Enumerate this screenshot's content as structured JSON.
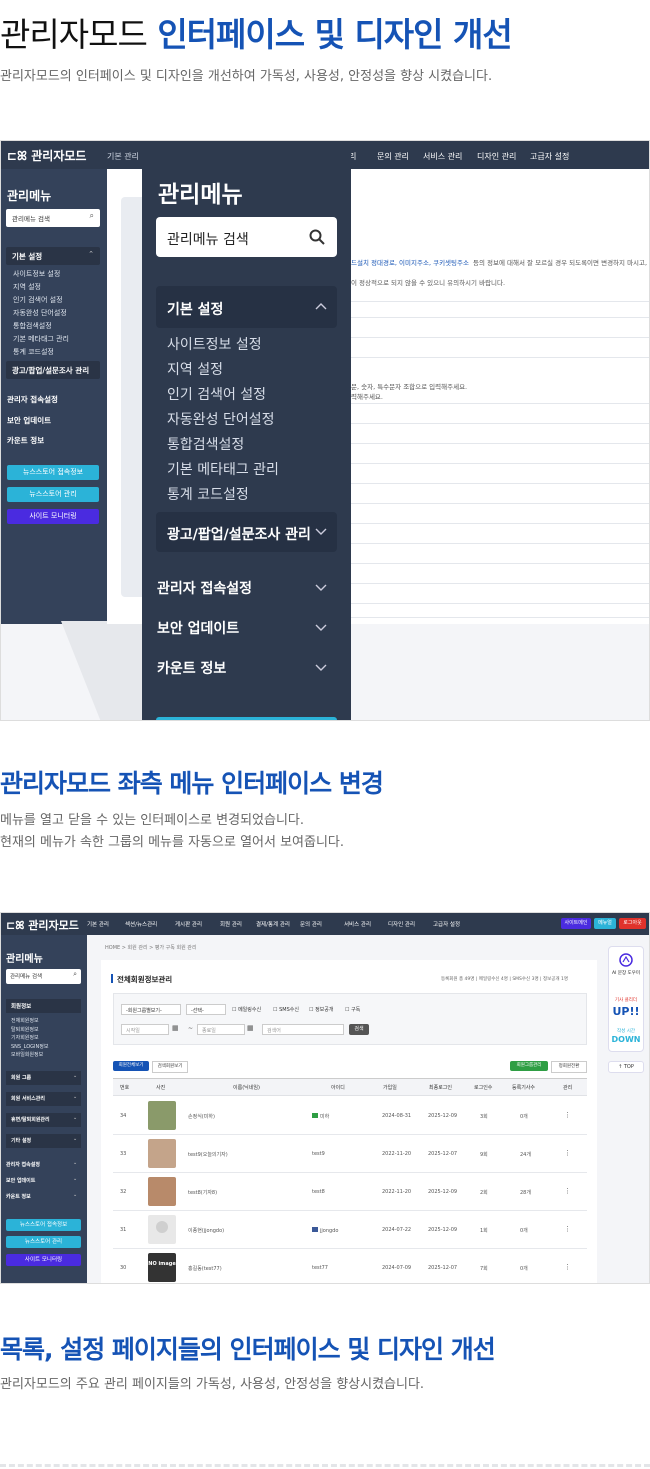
{
  "section1": {
    "title_normal": "관리자모드",
    "title_blue": "인터페이스 및 디자인 개선",
    "desc": "관리자모드의 인터페이스 및 디자인을 개선하여 가독성, 사용성, 안정성을 향상 시켰습니다."
  },
  "shot1": {
    "logo": "관리자모드",
    "topnav": [
      "기본 관리",
      "문의 관리",
      "서비스 관리",
      "디자인 관리",
      "고급자 설정"
    ],
    "sidebar_title": "관리메뉴",
    "search_placeholder": "관리메뉴 검색",
    "group_basic": "기본 설정",
    "basic_items": [
      "사이트정보 설정",
      "지역 설정",
      "인기 검색어 설정",
      "자동완성 단어설정",
      "통합검색설정",
      "기본 메타태그 관리",
      "통계 코드설정"
    ],
    "group_ad": "광고/팝업/설문조사 관리",
    "group_access": "관리자 접속설정",
    "group_security": "보안 업데이트",
    "group_count": "카운트 정보",
    "btn_news_info": "뉴스스토어 접속정보",
    "btn_news_manage": "뉴스스토어 관리",
    "btn_monitoring": "사이트 모니터링",
    "content_blue": "드설치 정대경로, 이미지주소, 쿠키셋팅주소",
    "content_text1": "등의 정보에 대해서 잘 모르실 경우 되도록이면 변경하지 마시고,",
    "content_text2": "이 정상적으로 되지 않을 수 있으니 유의하시기 바랍니다.",
    "content_text3": "문, 숫자, 특수문자 조합으로 입력해주세요.",
    "content_text4": "력해주세요."
  },
  "section2": {
    "title": "관리자모드 좌측 메뉴 인터페이스 변경",
    "desc1": "메뉴를 열고 닫을 수 있는 인터페이스로 변경되었습니다.",
    "desc2": "현재의 메뉴가 속한 그룹의 메뉴를 자동으로 열어서 보여줍니다."
  },
  "shot2": {
    "logo": "관리자모드",
    "topnav": [
      "기본 관리",
      "섹션/뉴스관리",
      "게시판 관리",
      "회원 관리",
      "결제/통계 관리",
      "문의 관리",
      "서비스 관리",
      "디자인 관리",
      "고급자 설정"
    ],
    "top_btn_site": "사이트메인",
    "top_btn_menu": "메뉴얼",
    "top_btn_logout": "로그아웃",
    "breadcrumb": "HOME > 회원 관리 > 평가 구독 회원 관리",
    "sidebar_title": "관리메뉴",
    "search_placeholder": "관리메뉴 검색",
    "group_member": "회원정보",
    "member_items": [
      "전체회원정보",
      "탈퇴회원정보",
      "기자회원정보",
      "SNS_LOGIN정보",
      "모바일회원정보"
    ],
    "side_groups": [
      "회원 그룹",
      "회원 서비스관리",
      "휴면/탈퇴회원관리",
      "기타 설정",
      "관리자 접속설정",
      "보안 업데이트",
      "카운트 정보"
    ],
    "btn_news_info": "뉴스스토어 접속정보",
    "btn_news_manage": "뉴스스토어 관리",
    "btn_monitoring": "사이트 모니터링",
    "page_title": "전체회원정보관리",
    "stats": "등록회원 총 49명 | 메일링수신 4명 | SMS수신 3명 | 정보공개 1명",
    "filter_group": "-회원그룹별보기-",
    "filter_select": "-선택-",
    "chk_mail": "메일링수신",
    "chk_sms": "SMS수신",
    "chk_info": "정보공개",
    "chk_sub": "구독",
    "date_start": "시작일",
    "date_end": "종료일",
    "keyword": "검색어",
    "search_btn": "검색",
    "tab_all": "회원전체보기",
    "tab_search": "검색회원보기",
    "btn_group": "회원그룹관리",
    "btn_auth": "정회원전환",
    "columns": [
      "번호",
      "사진",
      "이름(닉네임)",
      "아이디",
      "가입일",
      "최종로그인",
      "로그인수",
      "등록기사수",
      "관리"
    ],
    "rows": [
      {
        "no": "34",
        "name": "손정식(미하)",
        "id": "미하",
        "join": "2024-08-31",
        "last": "2025-12-09",
        "logins": "3회",
        "articles": "0개",
        "thumb": "#8a9a6a"
      },
      {
        "no": "33",
        "name": "test9(오늘의기자)",
        "id": "test9",
        "join": "2022-11-20",
        "last": "2025-12-07",
        "logins": "9회",
        "articles": "24개",
        "thumb": "#c4a48a"
      },
      {
        "no": "32",
        "name": "test8(기자8)",
        "id": "test8",
        "join": "2022-11-20",
        "last": "2025-12-09",
        "logins": "2회",
        "articles": "28개",
        "thumb": "#b88a6a"
      },
      {
        "no": "31",
        "name": "이종현(jjongdo)",
        "id": "jjongdo",
        "join": "2024-07-22",
        "last": "2025-12-09",
        "logins": "1회",
        "articles": "0개",
        "thumb": "#e8e8e8"
      },
      {
        "no": "30",
        "name": "홍길동(test77)",
        "id": "test77",
        "join": "2024-07-09",
        "last": "2025-12-07",
        "logins": "7회",
        "articles": "0개",
        "thumb": "#333333"
      }
    ],
    "no_image": "NO image",
    "right_ai": "AI 문장 도우미",
    "right_hit": "기사 클리더",
    "right_up": "UP!!",
    "right_time": "작성 시간",
    "right_down": "DOWN",
    "right_top": "TOP"
  },
  "section3": {
    "title": "목록, 설정 페이지들의 인터페이스 및 디자인 개선",
    "desc": "관리자모드의 주요 관리 페이지들의 가독성, 사용성, 안정성을 향상시켰습니다."
  },
  "colors": {
    "brand_blue": "#1553b5",
    "navy": "#2e3a4e",
    "cyan": "#2bb3d8",
    "purple": "#4a2be0"
  }
}
